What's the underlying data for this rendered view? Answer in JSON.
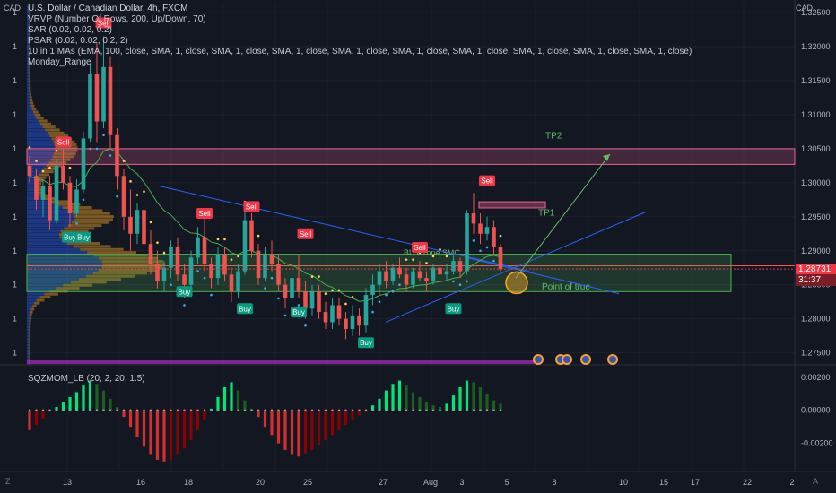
{
  "chart_data": {
    "type": "candlestick",
    "symbol": "U.S. Dollar / Canadian Dollar, 4h, FXCM",
    "currency": "CAD",
    "indicators": [
      "VRVP (Number Of Rows, 200, Up/Down, 70)",
      "SAR (0.02, 0.02, 0.2)",
      "PSAR (0.02, 0.02, 0.2, 2)",
      "10 in 1 MAs (EMA, 100, close, SMA, 1, close, SMA, 1, close, SMA, 1, close, SMA, 1, close, SMA, 1, close, SMA, 1, close, SMA, 1, close, SMA, 1, close, SMA, 1, close)",
      "Monday_Range"
    ],
    "price_ticks": [
      "1.32500",
      "1.32000",
      "1.31500",
      "1.31000",
      "1.30500",
      "1.30000",
      "1.29500",
      "1.29000",
      "1.28500",
      "1.28000",
      "1.27500"
    ],
    "y_range": [
      1.2735,
      1.3262
    ],
    "x_ticks": [
      "13",
      "16",
      "18",
      "20",
      "25",
      "27",
      "Aug",
      "3",
      "5",
      "8",
      "10",
      "15",
      "17",
      "22",
      "2"
    ],
    "current_price": "1.28731",
    "countdown": "31:37",
    "zones": [
      {
        "label": "TP2",
        "top": 1.305,
        "bottom": 1.3027,
        "color": "#f06292"
      },
      {
        "label": "BUY zone SMC",
        "top": 1.2895,
        "bottom": 1.284,
        "color": "#4caf50"
      }
    ],
    "annotations": [
      "TP1",
      "Point of true"
    ],
    "signals": [
      {
        "type": "Sell",
        "time": 11,
        "price": 1.3235
      },
      {
        "type": "Sell",
        "time": 5,
        "price": 1.306
      },
      {
        "type": "Sell",
        "time": 26,
        "price": 1.2955
      },
      {
        "type": "Sell",
        "time": 33,
        "price": 1.2965
      },
      {
        "type": "Sell",
        "time": 41,
        "price": 1.2925
      },
      {
        "type": "Sell",
        "time": 58,
        "price": 1.2905
      },
      {
        "type": "Sell",
        "time": 68,
        "price": 1.3003
      },
      {
        "type": "Buy",
        "time": 6,
        "price": 1.292
      },
      {
        "type": "Buy",
        "time": 8,
        "price": 1.292
      },
      {
        "type": "Buy",
        "time": 23,
        "price": 1.284
      },
      {
        "type": "Buy",
        "time": 32,
        "price": 1.2815
      },
      {
        "type": "Buy",
        "time": 40,
        "price": 1.281
      },
      {
        "type": "Buy",
        "time": 50,
        "price": 1.2765
      },
      {
        "type": "Buy",
        "time": 63,
        "price": 1.2815
      }
    ],
    "candles": [
      [
        1.3025,
        1.304,
        1.3,
        1.301
      ],
      [
        1.301,
        1.302,
        1.296,
        1.2975
      ],
      [
        1.2975,
        1.3005,
        1.295,
        1.2995
      ],
      [
        1.2995,
        1.301,
        1.293,
        1.2945
      ],
      [
        1.2945,
        1.3035,
        1.294,
        1.3025
      ],
      [
        1.3025,
        1.305,
        1.299,
        1.3
      ],
      [
        1.3,
        1.301,
        1.2935,
        1.2955
      ],
      [
        1.2955,
        1.3005,
        1.295,
        1.299
      ],
      [
        1.299,
        1.3075,
        1.2985,
        1.3065
      ],
      [
        1.3065,
        1.3175,
        1.306,
        1.316
      ],
      [
        1.316,
        1.3205,
        1.306,
        1.309
      ],
      [
        1.309,
        1.3215,
        1.308,
        1.317
      ],
      [
        1.317,
        1.3185,
        1.305,
        1.307
      ],
      [
        1.307,
        1.308,
        1.299,
        1.301
      ],
      [
        1.301,
        1.302,
        1.293,
        1.295
      ],
      [
        1.295,
        1.299,
        1.29,
        1.2925
      ],
      [
        1.2925,
        1.297,
        1.291,
        1.296
      ],
      [
        1.296,
        1.2975,
        1.2895,
        1.291
      ],
      [
        1.291,
        1.293,
        1.2865,
        1.288
      ],
      [
        1.288,
        1.29,
        1.2845,
        1.2855
      ],
      [
        1.2855,
        1.2885,
        1.284,
        1.2875
      ],
      [
        1.2875,
        1.2915,
        1.286,
        1.2905
      ],
      [
        1.2905,
        1.292,
        1.2855,
        1.2865
      ],
      [
        1.2865,
        1.288,
        1.283,
        1.285
      ],
      [
        1.285,
        1.29,
        1.2845,
        1.289
      ],
      [
        1.289,
        1.2935,
        1.288,
        1.292
      ],
      [
        1.292,
        1.295,
        1.287,
        1.288
      ],
      [
        1.288,
        1.289,
        1.2845,
        1.286
      ],
      [
        1.286,
        1.2905,
        1.285,
        1.2895
      ],
      [
        1.2895,
        1.2905,
        1.2855,
        1.2865
      ],
      [
        1.2865,
        1.2875,
        1.2825,
        1.284
      ],
      [
        1.284,
        1.288,
        1.283,
        1.287
      ],
      [
        1.287,
        1.296,
        1.2865,
        1.2945
      ],
      [
        1.2945,
        1.2955,
        1.289,
        1.29
      ],
      [
        1.29,
        1.291,
        1.285,
        1.286
      ],
      [
        1.286,
        1.2905,
        1.2855,
        1.2895
      ],
      [
        1.2895,
        1.2915,
        1.287,
        1.288
      ],
      [
        1.288,
        1.2895,
        1.284,
        1.285
      ],
      [
        1.285,
        1.286,
        1.2815,
        1.283
      ],
      [
        1.283,
        1.287,
        1.2825,
        1.286
      ],
      [
        1.286,
        1.2895,
        1.283,
        1.284
      ],
      [
        1.284,
        1.2855,
        1.28,
        1.2815
      ],
      [
        1.2815,
        1.285,
        1.2805,
        1.284
      ],
      [
        1.284,
        1.285,
        1.28,
        1.281
      ],
      [
        1.281,
        1.2825,
        1.2785,
        1.2795
      ],
      [
        1.2795,
        1.283,
        1.2785,
        1.282
      ],
      [
        1.282,
        1.283,
        1.279,
        1.28
      ],
      [
        1.28,
        1.281,
        1.277,
        1.2785
      ],
      [
        1.2785,
        1.282,
        1.2775,
        1.2805
      ],
      [
        1.2805,
        1.2815,
        1.2775,
        1.279
      ],
      [
        1.279,
        1.2845,
        1.278,
        1.2835
      ],
      [
        1.2835,
        1.2865,
        1.282,
        1.285
      ],
      [
        1.285,
        1.288,
        1.2835,
        1.287
      ],
      [
        1.287,
        1.2885,
        1.2845,
        1.2855
      ],
      [
        1.2855,
        1.288,
        1.285,
        1.2875
      ],
      [
        1.2875,
        1.289,
        1.286,
        1.2865
      ],
      [
        1.2865,
        1.2875,
        1.284,
        1.285
      ],
      [
        1.285,
        1.2875,
        1.2845,
        1.287
      ],
      [
        1.287,
        1.2885,
        1.2855,
        1.286
      ],
      [
        1.286,
        1.287,
        1.284,
        1.2855
      ],
      [
        1.2855,
        1.288,
        1.285,
        1.2875
      ],
      [
        1.2875,
        1.289,
        1.286,
        1.2865
      ],
      [
        1.2865,
        1.288,
        1.2855,
        1.287
      ],
      [
        1.287,
        1.2895,
        1.2865,
        1.2885
      ],
      [
        1.2885,
        1.289,
        1.286,
        1.287
      ],
      [
        1.287,
        1.296,
        1.2865,
        1.2955
      ],
      [
        1.2955,
        1.2985,
        1.2925,
        1.294
      ],
      [
        1.294,
        1.2955,
        1.291,
        1.2925
      ],
      [
        1.2925,
        1.295,
        1.2915,
        1.2935
      ],
      [
        1.2935,
        1.2945,
        1.2895,
        1.2905
      ],
      [
        1.2905,
        1.291,
        1.287,
        1.2873
      ]
    ],
    "oscillator": {
      "label": "SQZMOM_LB (20, 2, 20, 1.5)",
      "ticks": [
        "0.00200",
        "0.00000",
        "-0.00200"
      ],
      "y_range": [
        -0.0036,
        0.0027
      ],
      "values": [
        -0.0012,
        -0.0009,
        -0.0005,
        -0.0001,
        0.0002,
        0.0005,
        0.0008,
        0.0011,
        0.0015,
        0.0018,
        0.0016,
        0.0012,
        0.0007,
        0.0002,
        -0.0004,
        -0.001,
        -0.0016,
        -0.0022,
        -0.0027,
        -0.003,
        -0.0031,
        -0.003,
        -0.0027,
        -0.0023,
        -0.0018,
        -0.0012,
        -0.0006,
        0.0001,
        0.0008,
        0.0014,
        0.0017,
        0.0012,
        0.0006,
        0.0001,
        -0.0004,
        -0.001,
        -0.0015,
        -0.002,
        -0.0024,
        -0.0027,
        -0.0028,
        -0.0026,
        -0.0024,
        -0.0021,
        -0.0018,
        -0.0015,
        -0.0012,
        -0.0009,
        -0.0006,
        -0.0003,
        -0.0001,
        0.0003,
        0.0007,
        0.0012,
        0.0016,
        0.0018,
        0.0015,
        0.0011,
        0.0008,
        0.0005,
        0.0003,
        0.0002,
        0.0004,
        0.0009,
        0.0014,
        0.0018,
        0.0017,
        0.0014,
        0.001,
        0.0006,
        0.0004
      ]
    }
  }
}
